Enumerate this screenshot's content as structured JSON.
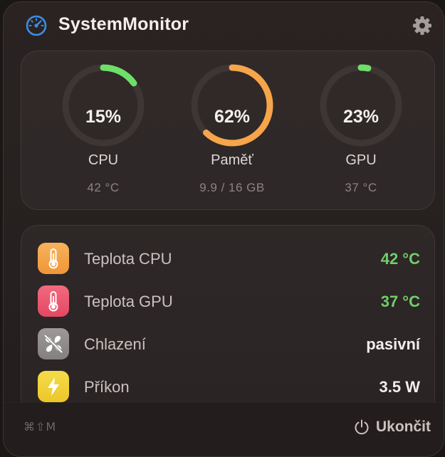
{
  "app": {
    "title": "SystemMonitor"
  },
  "icons": {
    "app": "speedometer-icon",
    "settings": "gear-icon"
  },
  "gauges": [
    {
      "value": 0.15,
      "value_text": "15%",
      "label": "CPU",
      "sub": "42 °C",
      "color": "#6ee06a"
    },
    {
      "value": 0.62,
      "value_text": "62%",
      "label": "Paměť",
      "sub": "9.9 / 16 GB",
      "color": "#f6a54a"
    },
    {
      "value": 0.03,
      "value_text": "23%",
      "label": "GPU",
      "sub": "37 °C",
      "color": "#6ee06a"
    }
  ],
  "stats": [
    {
      "label": "Teplota CPU",
      "value": "42 °C",
      "icon": "thermometer-icon",
      "icon_color": "#f4a345",
      "highlight": true
    },
    {
      "label": "Teplota GPU",
      "value": "37 °C",
      "icon": "thermometer-icon",
      "icon_color": "#ec5a73",
      "highlight": true
    },
    {
      "label": "Chlazení",
      "value": "pasivní",
      "icon": "fan-icon",
      "icon_color": "#8e8a89",
      "highlight": false
    },
    {
      "label": "Příkon",
      "value": "3.5 W",
      "icon": "bolt-icon",
      "icon_color": "#f1d23a",
      "highlight": false
    }
  ],
  "footer": {
    "shortcut": "⌘⇧M",
    "quit_label": "Ukončit",
    "quit_icon": "power-icon"
  }
}
